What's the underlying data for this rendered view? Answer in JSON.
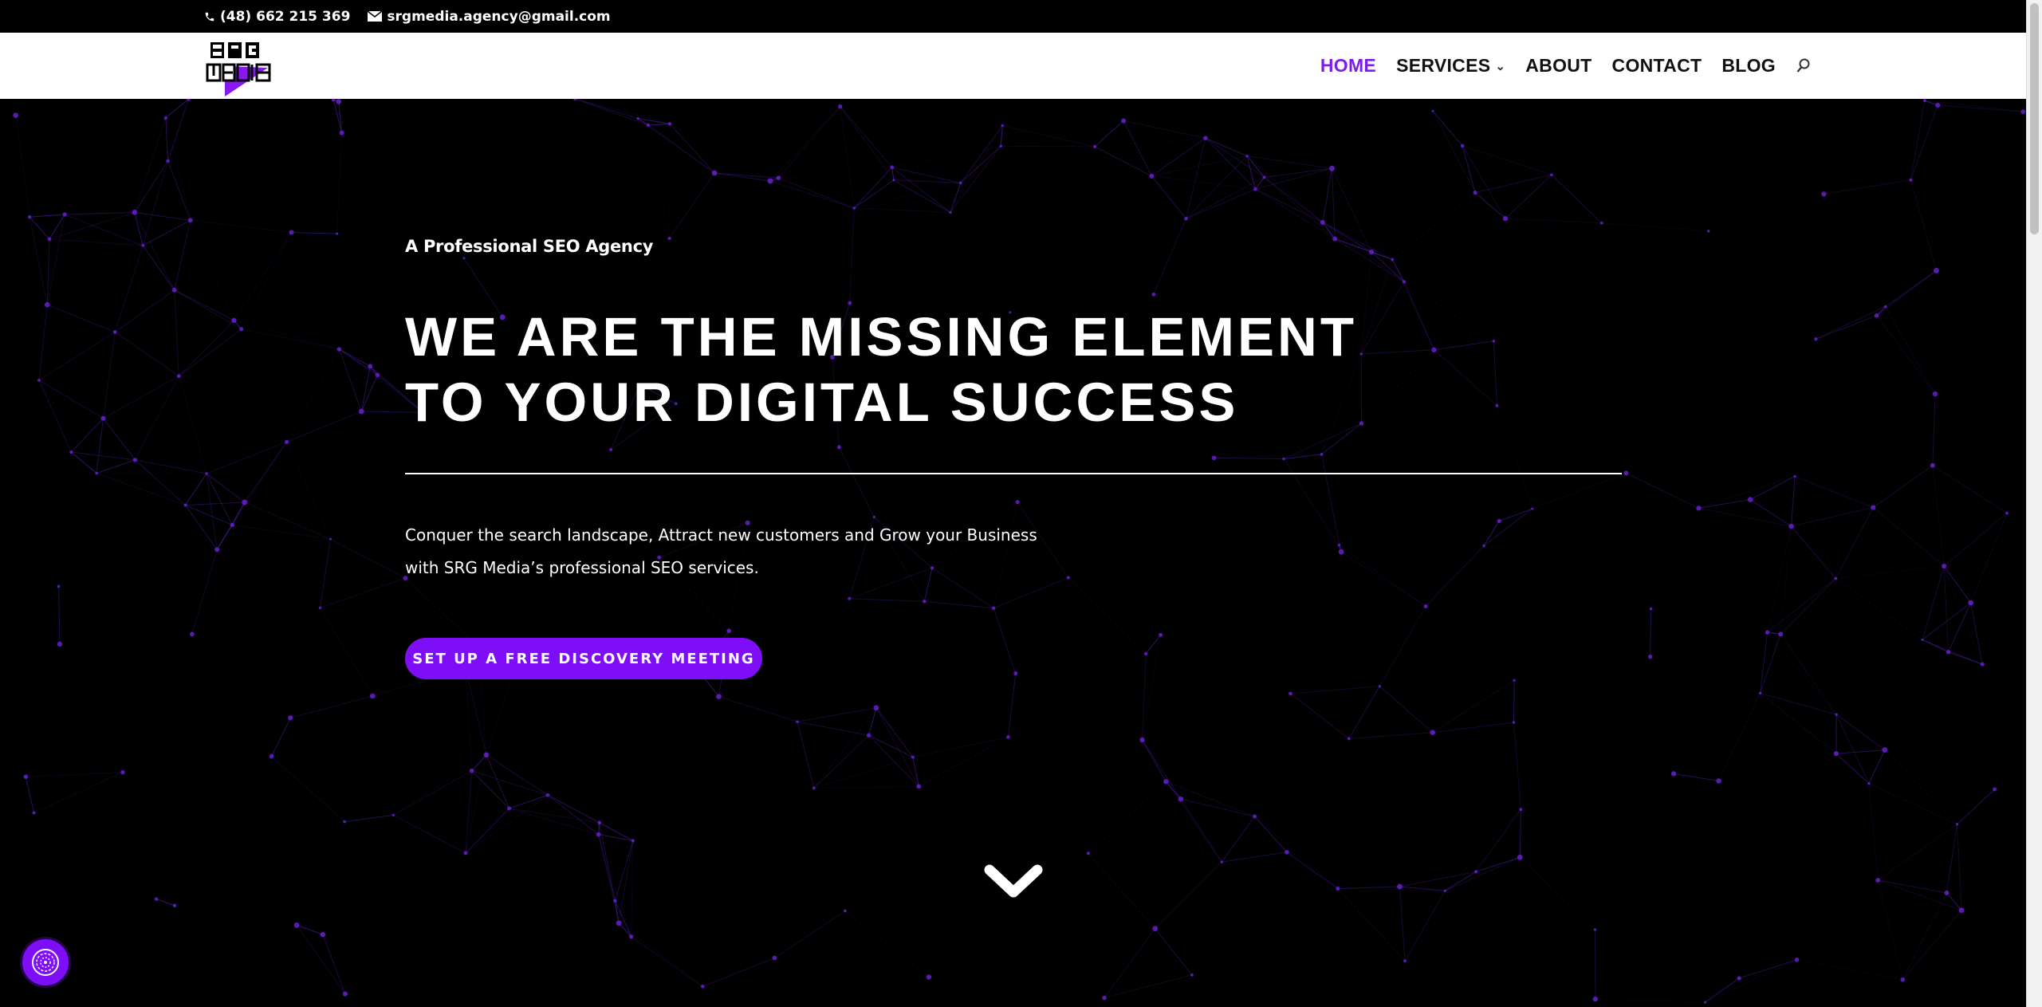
{
  "topbar": {
    "phone": "(48) 662 215 369",
    "email": "srgmedia.agency@gmail.com"
  },
  "header": {
    "logo_alt": "SRG MEDIA",
    "nav": [
      {
        "label": "HOME",
        "active": true
      },
      {
        "label": "SERVICES",
        "has_dropdown": true
      },
      {
        "label": "ABOUT"
      },
      {
        "label": "CONTACT"
      },
      {
        "label": "BLOG"
      }
    ],
    "search_icon": "search-icon"
  },
  "hero": {
    "tagline": "A Professional SEO Agency",
    "headline_line1": "WE ARE THE MISSING ELEMENT",
    "headline_line2": "TO YOUR DIGITAL SUCCESS",
    "description": "Conquer the search landscape, Attract new customers and Grow your Business with SRG Media’s professional SEO services.",
    "cta_label": "SET UP A FREE DISCOVERY MEETING",
    "scroll_icon": "chevron-down-icon",
    "cookie_icon": "cookie-icon"
  },
  "colors": {
    "accent": "#7d0ef7",
    "nav_active": "#7d1ee6",
    "background": "#000000",
    "network_lines": "#4a1a9a"
  }
}
